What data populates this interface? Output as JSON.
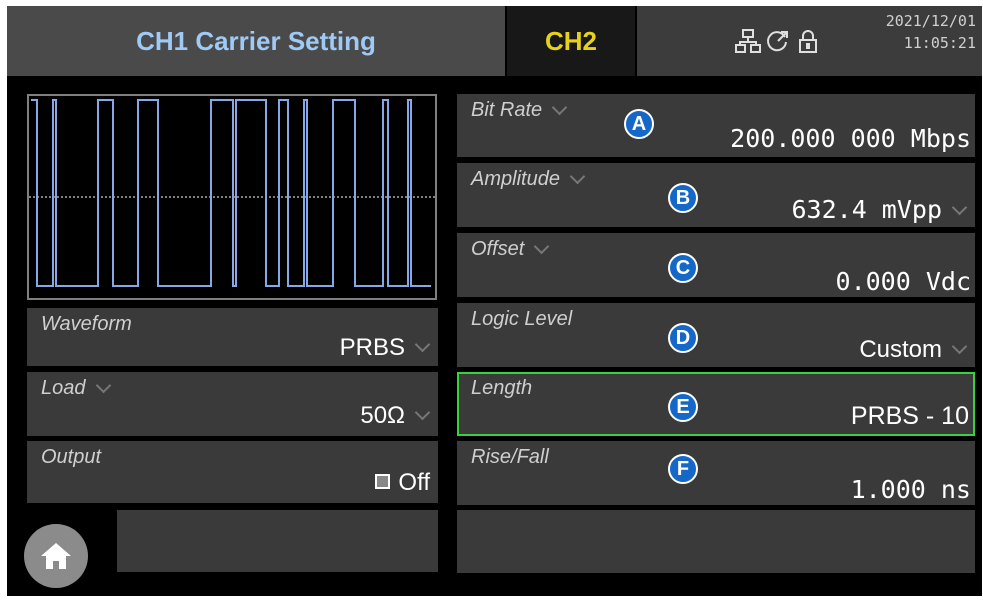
{
  "header": {
    "title": "CH1 Carrier Setting",
    "ch2": "CH2",
    "date": "2021/12/01",
    "time": "11:05:21",
    "icons": [
      "network-icon",
      "clock-rotate-icon",
      "lock-icon"
    ]
  },
  "left": {
    "waveform": {
      "label": "Waveform",
      "value": "PRBS"
    },
    "load": {
      "label": "Load",
      "value": "50Ω"
    },
    "output": {
      "label": "Output",
      "value": "Off"
    }
  },
  "right": {
    "bit_rate": {
      "label": "Bit Rate",
      "value": "200.000 000 Mbps",
      "badge": "A"
    },
    "amplitude": {
      "label": "Amplitude",
      "value": "632.4 mVpp",
      "badge": "B"
    },
    "offset": {
      "label": "Offset",
      "value": "0.000 Vdc",
      "badge": "C"
    },
    "logic_level": {
      "label": "Logic Level",
      "value": "Custom",
      "badge": "D"
    },
    "length": {
      "label": "Length",
      "value": "PRBS - 10",
      "badge": "E"
    },
    "rise_fall": {
      "label": "Rise/Fall",
      "value": "1.000 ns",
      "badge": "F"
    }
  },
  "colors": {
    "accent_blue": "#1567c8",
    "title_blue": "#9ecaf5",
    "ch2_yellow": "#e6d21c",
    "selected_green": "#39d23a",
    "waveform": "#86a8e6"
  }
}
